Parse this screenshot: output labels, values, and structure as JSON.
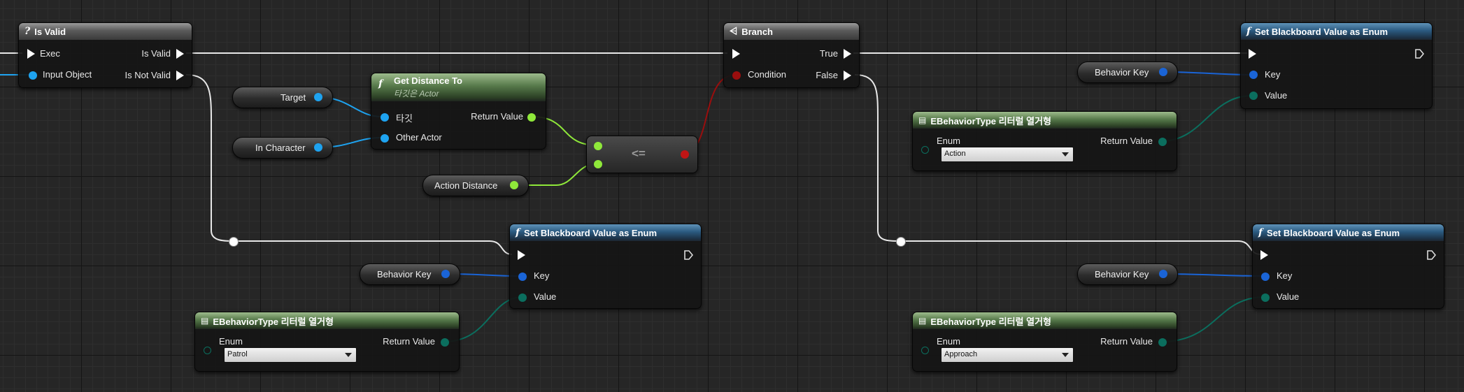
{
  "graph": {
    "is_valid": {
      "title": "Is Valid",
      "icon": "?",
      "exec": "Exec",
      "is_valid": "Is Valid",
      "input_object": "Input Object",
      "is_not_valid": "Is Not Valid"
    },
    "branch": {
      "title": "Branch",
      "true": "True",
      "condition": "Condition",
      "false": "False"
    },
    "get_distance": {
      "title": "Get Distance To",
      "subtitle": "타깃은 Actor",
      "target_pin": "타깃",
      "other_actor": "Other Actor",
      "return_value": "Return Value"
    },
    "compare": {
      "operator": "<="
    },
    "variables": {
      "target": "Target",
      "in_character": "In Character",
      "action_distance": "Action Distance",
      "behavior_key_1": "Behavior Key",
      "behavior_key_2": "Behavior Key",
      "behavior_key_3": "Behavior Key"
    },
    "set_bb_1": {
      "title": "Set Blackboard Value as Enum",
      "key": "Key",
      "value": "Value"
    },
    "set_bb_2": {
      "title": "Set Blackboard Value as Enum",
      "key": "Key",
      "value": "Value"
    },
    "set_bb_3": {
      "title": "Set Blackboard Value as Enum",
      "key": "Key",
      "value": "Value"
    },
    "enum_action": {
      "title": "EBehaviorType 리터럴 열거형",
      "enum_label": "Enum",
      "selected": "Action",
      "return_value": "Return Value"
    },
    "enum_patrol": {
      "title": "EBehaviorType 리터럴 열거형",
      "enum_label": "Enum",
      "selected": "Patrol",
      "return_value": "Return Value"
    },
    "enum_approach": {
      "title": "EBehaviorType 리터럴 열거형",
      "enum_label": "Enum",
      "selected": "Approach",
      "return_value": "Return Value"
    },
    "colors": {
      "exec": "#ffffff",
      "object": "#1ea3f0",
      "name": "#1a64d6",
      "byte": "#0b6e5e",
      "bool": "#9a0e0e",
      "float": "#8fe83a"
    },
    "icons": {
      "function": "function-f-icon",
      "branch": "branch-icon",
      "enum": "enum-literal-icon",
      "macro": "question-icon"
    }
  }
}
